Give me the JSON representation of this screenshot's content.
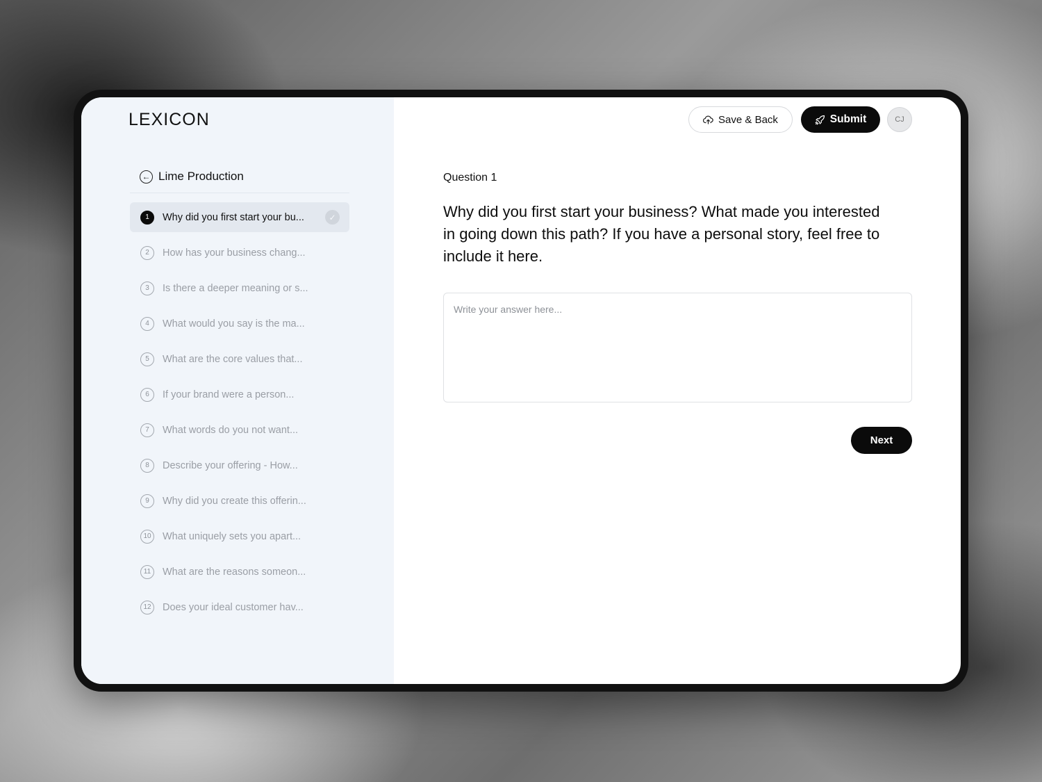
{
  "app": {
    "logo": "LEXICON"
  },
  "sidebar": {
    "project_name": "Lime Production",
    "questions": [
      {
        "number": "1",
        "text": "Why did you first start your bu...",
        "active": true,
        "completed": true
      },
      {
        "number": "2",
        "text": "How has your business chang..."
      },
      {
        "number": "3",
        "text": "Is there a deeper meaning or s..."
      },
      {
        "number": "4",
        "text": "What would you say is the ma..."
      },
      {
        "number": "5",
        "text": "What are the core values that..."
      },
      {
        "number": "6",
        "text": "If your brand were a person..."
      },
      {
        "number": "7",
        "text": "What words do you not want..."
      },
      {
        "number": "8",
        "text": "Describe your offering - How..."
      },
      {
        "number": "9",
        "text": "Why did you create this offerin..."
      },
      {
        "number": "10",
        "text": "What uniquely sets you apart..."
      },
      {
        "number": "11",
        "text": "What are the reasons someon..."
      },
      {
        "number": "12",
        "text": "Does your ideal customer hav..."
      }
    ]
  },
  "header": {
    "save_label": "Save & Back",
    "save_icon": "cloud-upload-icon",
    "submit_label": "Submit",
    "submit_icon": "rocket-icon",
    "avatar_initials": "CJ"
  },
  "main": {
    "question_label": "Question 1",
    "question_text": "Why did you first start your business? What made you interested in going down this path? If you have a personal story, feel free to include it here.",
    "answer_placeholder": "Write your answer here...",
    "answer_value": "",
    "next_label": "Next"
  },
  "colors": {
    "accent": "#0b0b0b",
    "sidebar_bg": "#f1f5fa",
    "active_item_bg": "#e3e8ef"
  }
}
